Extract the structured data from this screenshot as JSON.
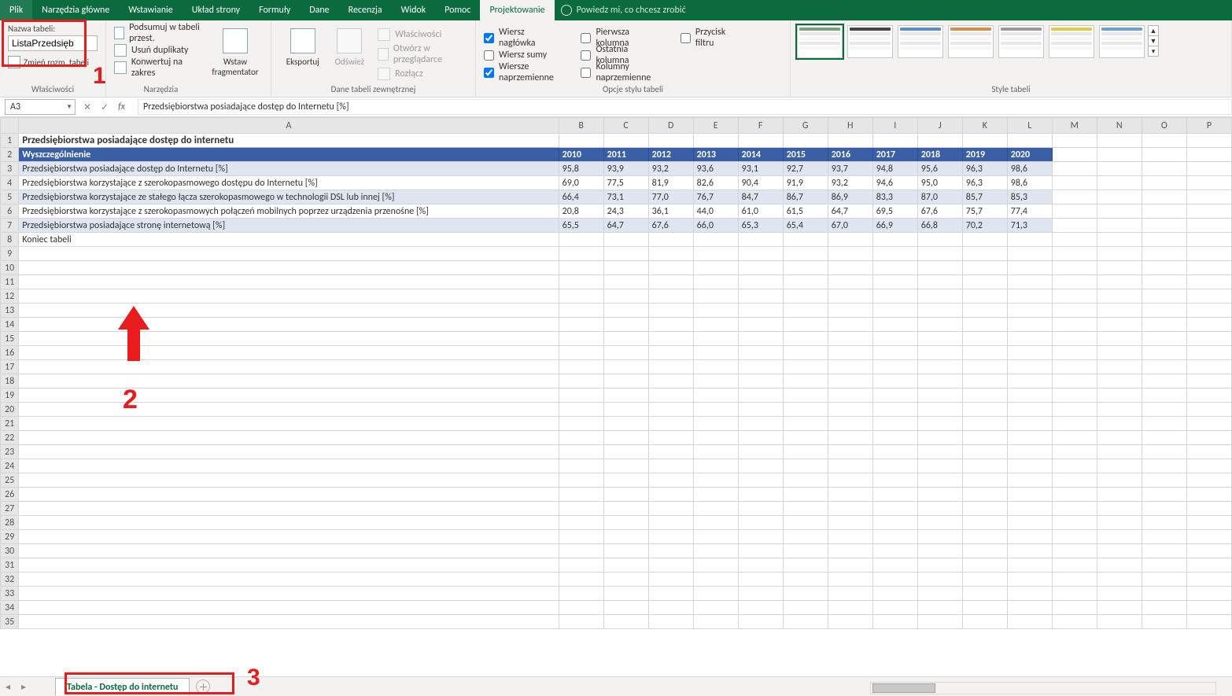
{
  "tabs": {
    "items": [
      "Plik",
      "Narzędzia główne",
      "Wstawianie",
      "Układ strony",
      "Formuły",
      "Dane",
      "Recenzja",
      "Widok",
      "Pomoc",
      "Projektowanie"
    ],
    "active": "Projektowanie",
    "tellme": "Powiedz mi, co chcesz zrobić"
  },
  "ribbon": {
    "props": {
      "label": "Nazwa tabeli:",
      "value": "ListaPrzedsięb",
      "resize": "Zmień rozm. tabeli",
      "group": "Właściwości"
    },
    "tools": {
      "pivot": "Podsumuj w tabeli przest.",
      "dup": "Usuń duplikaty",
      "conv": "Konwertuj na zakres",
      "slicer": "Wstaw fragmentator",
      "group": "Narzędzia"
    },
    "ext": {
      "export": "Eksportuj",
      "refresh": "Odśwież",
      "props": "Właściwości",
      "open": "Otwórz w przeglądarce",
      "unlink": "Rozłącz",
      "group": "Dane tabeli zewnętrznej"
    },
    "styleopt": {
      "hdr": "Wiersz nagłówka",
      "tot": "Wiersz sumy",
      "band": "Wiersze naprzemienne",
      "first": "Pierwsza kolumna",
      "last": "Ostatnia kolumna",
      "bandc": "Kolumny naprzemienne",
      "filter": "Przycisk filtru",
      "group": "Opcje stylu tabeli"
    },
    "styles": {
      "group": "Style tabeli"
    }
  },
  "formula": {
    "ref": "A3",
    "value": "Przedsiębiorstwa posiadające dostęp do Internetu [%]"
  },
  "cols": [
    "A",
    "B",
    "C",
    "D",
    "E",
    "F",
    "G",
    "H",
    "I",
    "J",
    "K",
    "L",
    "M",
    "N",
    "O",
    "P"
  ],
  "title": "Przedsiębiorstwa posiadające dostęp do internetu",
  "headers": [
    "Wyszczególnienie",
    "2010",
    "2011",
    "2012",
    "2013",
    "2014",
    "2015",
    "2016",
    "2017",
    "2018",
    "2019",
    "2020"
  ],
  "rows": [
    {
      "label": "Przedsiębiorstwa posiadające dostęp do Internetu [%]",
      "v": [
        "95,8",
        "93,9",
        "93,2",
        "93,6",
        "93,1",
        "92,7",
        "93,7",
        "94,8",
        "95,6",
        "96,3",
        "98,6"
      ]
    },
    {
      "label": "Przedsiębiorstwa korzystające z szerokopasmowego dostępu do Internetu [%]",
      "v": [
        "69,0",
        "77,5",
        "81,9",
        "82,6",
        "90,4",
        "91,9",
        "93,2",
        "94,6",
        "95,0",
        "96,3",
        "98,6"
      ]
    },
    {
      "label": "Przedsiębiorstwa korzystające ze stałego łącza szerokopasmowego w technologii DSL lub innej [%]",
      "v": [
        "66,4",
        "73,1",
        "77,0",
        "76,7",
        "84,7",
        "86,7",
        "86,9",
        "83,3",
        "87,0",
        "85,7",
        "85,3"
      ]
    },
    {
      "label": "Przedsiębiorstwa korzystające z szerokopasmowych połączeń mobilnych poprzez urządzenia przenośne [%]",
      "v": [
        "20,8",
        "24,3",
        "36,1",
        "44,0",
        "61,0",
        "61,5",
        "64,7",
        "69,5",
        "67,6",
        "75,7",
        "77,4"
      ]
    },
    {
      "label": "Przedsiębiorstwa posiadające stronę internetową [%]",
      "v": [
        "65,5",
        "64,7",
        "67,6",
        "66,0",
        "65,3",
        "65,4",
        "67,0",
        "66,9",
        "66,8",
        "70,2",
        "71,3"
      ]
    }
  ],
  "footer": "Koniec tabeli",
  "sheet": "Tabela - Dostęp do internetu",
  "annot": {
    "one": "1",
    "two": "2",
    "three": "3"
  }
}
